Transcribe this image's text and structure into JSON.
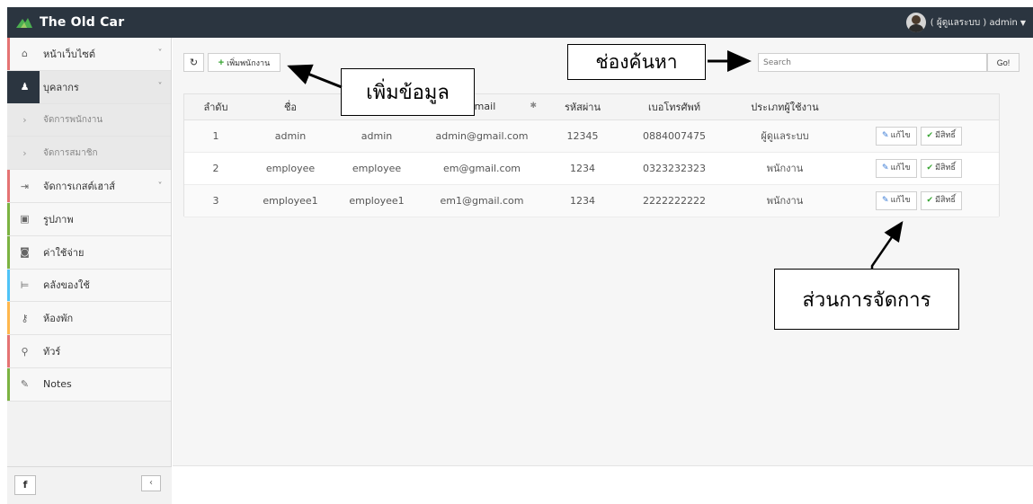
{
  "app": {
    "title": "The Old Car",
    "user_label": "( ผู้ดูแลระบบ ) admin"
  },
  "sidebar": {
    "items": [
      {
        "label": "หน้าเว็บไซต์",
        "icon": "home-icon",
        "glyph": "⌂",
        "chevron": "˅",
        "type": "item",
        "accent": "#e57373"
      },
      {
        "label": "บุคลากร",
        "icon": "user-icon",
        "glyph": "♟",
        "chevron": "˅",
        "type": "active",
        "accent": "#2b3540"
      },
      {
        "label": "จัดการพนักงาน",
        "icon": "chevron-right-icon",
        "glyph": "›",
        "chevron": "",
        "type": "sub",
        "accent": ""
      },
      {
        "label": "จัดการสมาชิก",
        "icon": "chevron-right-icon",
        "glyph": "›",
        "chevron": "",
        "type": "sub",
        "accent": ""
      },
      {
        "label": "จัดการเกสต์เฮาส์",
        "icon": "sign-in-icon",
        "glyph": "⇥",
        "chevron": "˅",
        "type": "item",
        "accent": "#e57373"
      },
      {
        "label": "รูปภาพ",
        "icon": "image-icon",
        "glyph": "▣",
        "chevron": "",
        "type": "item",
        "accent": "#7cb342"
      },
      {
        "label": "ค่าใช้จ่าย",
        "icon": "money-icon",
        "glyph": "◙",
        "chevron": "",
        "type": "item",
        "accent": "#7cb342"
      },
      {
        "label": "คลังของใช้",
        "icon": "cart-icon",
        "glyph": "⊨",
        "chevron": "",
        "type": "item",
        "accent": "#4fc3f7"
      },
      {
        "label": "ห้องพัก",
        "icon": "key-icon",
        "glyph": "⚷",
        "chevron": "",
        "type": "item",
        "accent": "#ffb74d"
      },
      {
        "label": "ทัวร์",
        "icon": "map-marker-icon",
        "glyph": "⚲",
        "chevron": "",
        "type": "item",
        "accent": "#e57373"
      },
      {
        "label": "Notes",
        "icon": "pencil-icon",
        "glyph": "✎",
        "chevron": "",
        "type": "item",
        "accent": "#7cb342"
      }
    ],
    "footer_button": "f",
    "collapse_button": "‹"
  },
  "toolbar": {
    "refresh_icon": "↻",
    "add_label": "เพิ่มพนักงาน",
    "search_placeholder": "Search",
    "search_go": "Go!"
  },
  "table": {
    "columns": [
      "ลำดับ",
      "ชื่อ",
      "",
      "Email",
      "รหัสผ่าน",
      "เบอโทรศัพท์",
      "ประเภทผู้ใช้งาน",
      ""
    ],
    "sort_icon": "✱",
    "edit_label": "แก้ไข",
    "perm_label": "มีสิทธิ์",
    "rows": [
      {
        "no": "1",
        "name": "admin",
        "username": "admin",
        "email": "admin@gmail.com",
        "password": "12345",
        "phone": "0884007475",
        "role": "ผู้ดูแลระบบ"
      },
      {
        "no": "2",
        "name": "employee",
        "username": "employee",
        "email": "em@gmail.com",
        "password": "1234",
        "phone": "0323232323",
        "role": "พนักงาน"
      },
      {
        "no": "3",
        "name": "employee1",
        "username": "employee1",
        "email": "em1@gmail.com",
        "password": "1234",
        "phone": "2222222222",
        "role": "พนักงาน"
      }
    ]
  },
  "annotations": {
    "add_data": "เพิ่มข้อมูล",
    "search_box": "ช่องค้นหา",
    "management": "ส่วนการจัดการ"
  },
  "colors": {
    "topbar": "#2b3540",
    "accent_green": "#3aa635",
    "accent_blue": "#3a7bd5"
  }
}
